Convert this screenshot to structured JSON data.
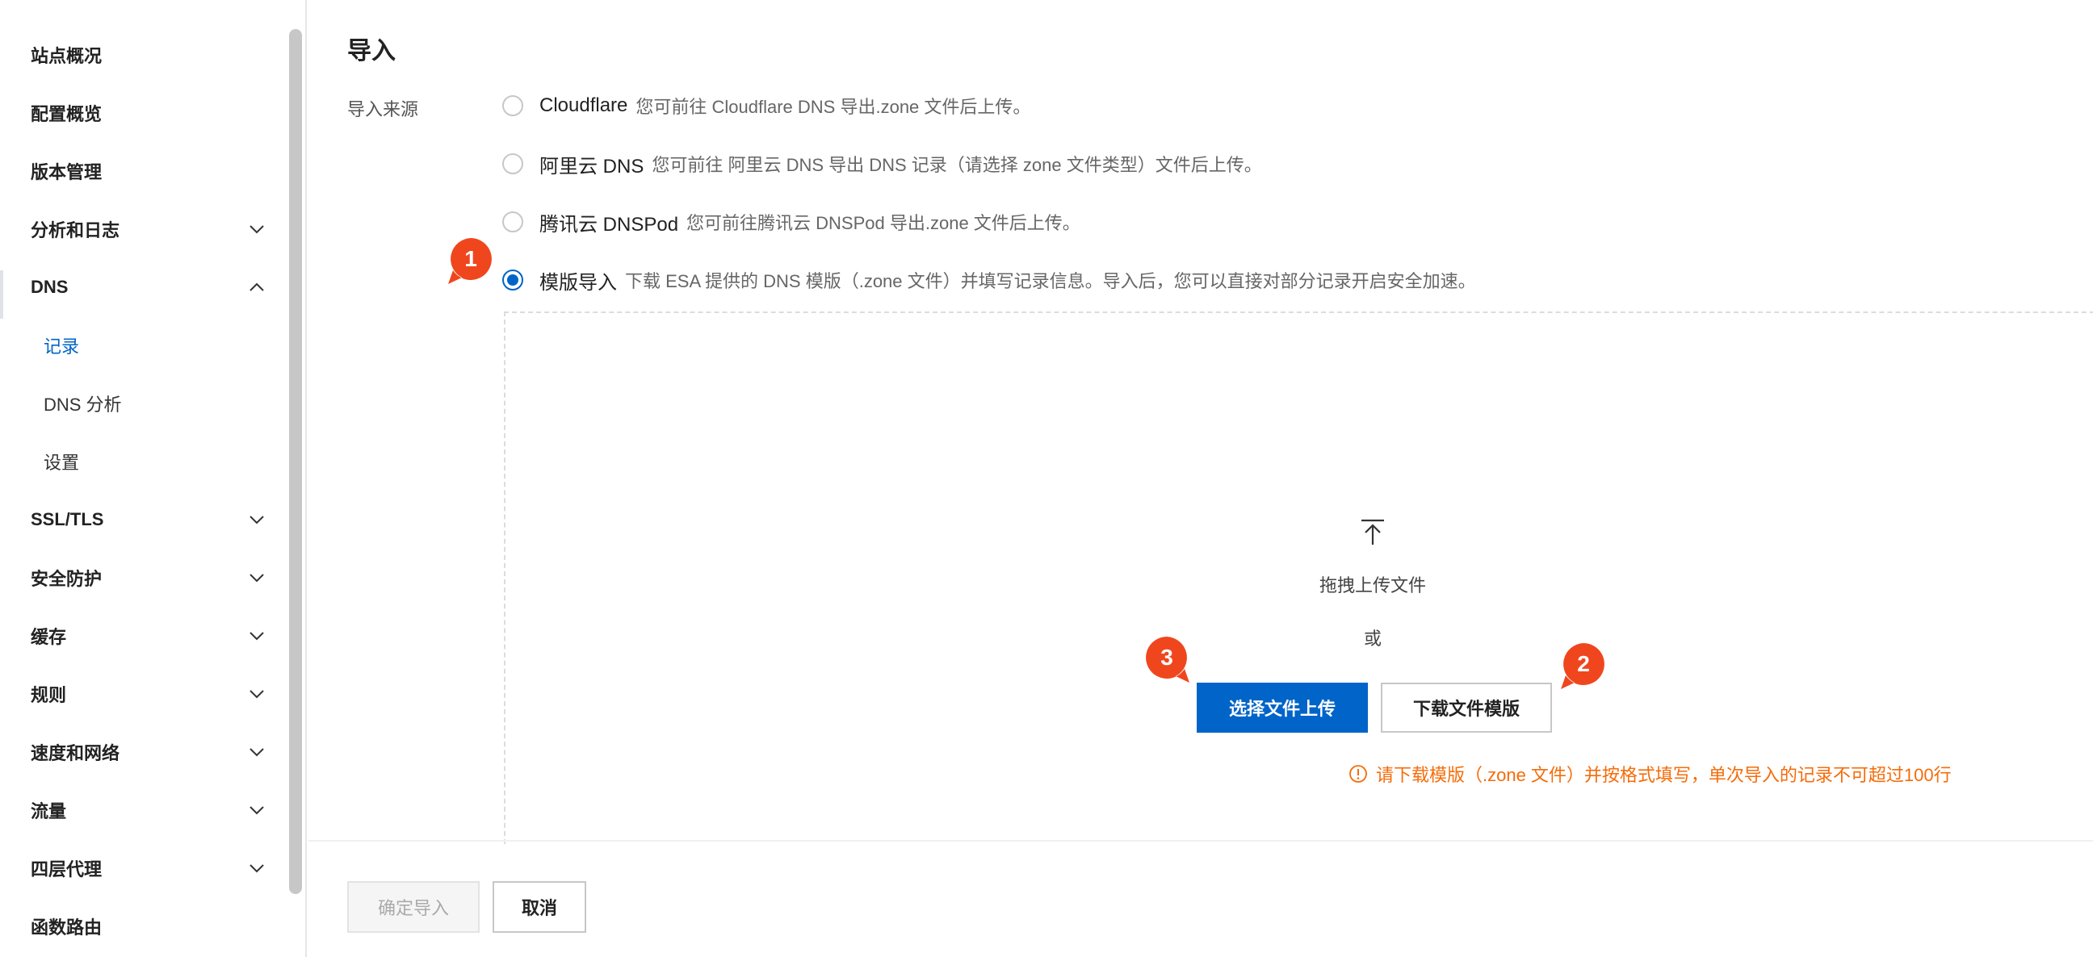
{
  "sidebar": {
    "items": [
      {
        "label": "站点概况",
        "expandable": false
      },
      {
        "label": "配置概览",
        "expandable": false
      },
      {
        "label": "版本管理",
        "expandable": false
      },
      {
        "label": "分析和日志",
        "expandable": true,
        "expanded": false
      },
      {
        "label": "DNS",
        "expandable": true,
        "expanded": true
      },
      {
        "label": "SSL/TLS",
        "expandable": true,
        "expanded": false
      },
      {
        "label": "安全防护",
        "expandable": true,
        "expanded": false
      },
      {
        "label": "缓存",
        "expandable": true,
        "expanded": false
      },
      {
        "label": "规则",
        "expandable": true,
        "expanded": false
      },
      {
        "label": "速度和网络",
        "expandable": true,
        "expanded": false
      },
      {
        "label": "流量",
        "expandable": true,
        "expanded": false
      },
      {
        "label": "四层代理",
        "expandable": true,
        "expanded": false
      },
      {
        "label": "函数路由",
        "expandable": false
      }
    ],
    "dns_children": [
      {
        "label": "记录",
        "active": true
      },
      {
        "label": "DNS 分析",
        "active": false
      },
      {
        "label": "设置",
        "active": false
      }
    ]
  },
  "main": {
    "title": "导入",
    "source_label": "导入来源",
    "options": [
      {
        "name": "Cloudflare",
        "desc": "您可前往 Cloudflare DNS 导出.zone 文件后上传。",
        "checked": false
      },
      {
        "name": "阿里云 DNS",
        "desc": "您可前往 阿里云 DNS 导出 DNS 记录（请选择 zone 文件类型）文件后上传。",
        "checked": false
      },
      {
        "name": "腾讯云 DNSPod",
        "desc": "您可前往腾讯云 DNSPod 导出.zone 文件后上传。",
        "checked": false
      },
      {
        "name": "模版导入",
        "desc": "下载 ESA 提供的 DNS 模版（.zone 文件）并填写记录信息。导入后，您可以直接对部分记录开启安全加速。",
        "checked": true
      }
    ],
    "dropzone": {
      "drag_text": "拖拽上传文件",
      "or_text": "或",
      "upload_button": "选择文件上传",
      "download_button": "下载文件模版",
      "hint": "请下载模版（.zone 文件）并按格式填写，单次导入的记录不可超过100行"
    },
    "footer": {
      "confirm": "确定导入",
      "cancel": "取消"
    }
  },
  "badges": [
    "1",
    "2",
    "3"
  ],
  "colors": {
    "primary": "#0064c8",
    "warning": "#f56c0a",
    "badge": "#f0461e"
  }
}
